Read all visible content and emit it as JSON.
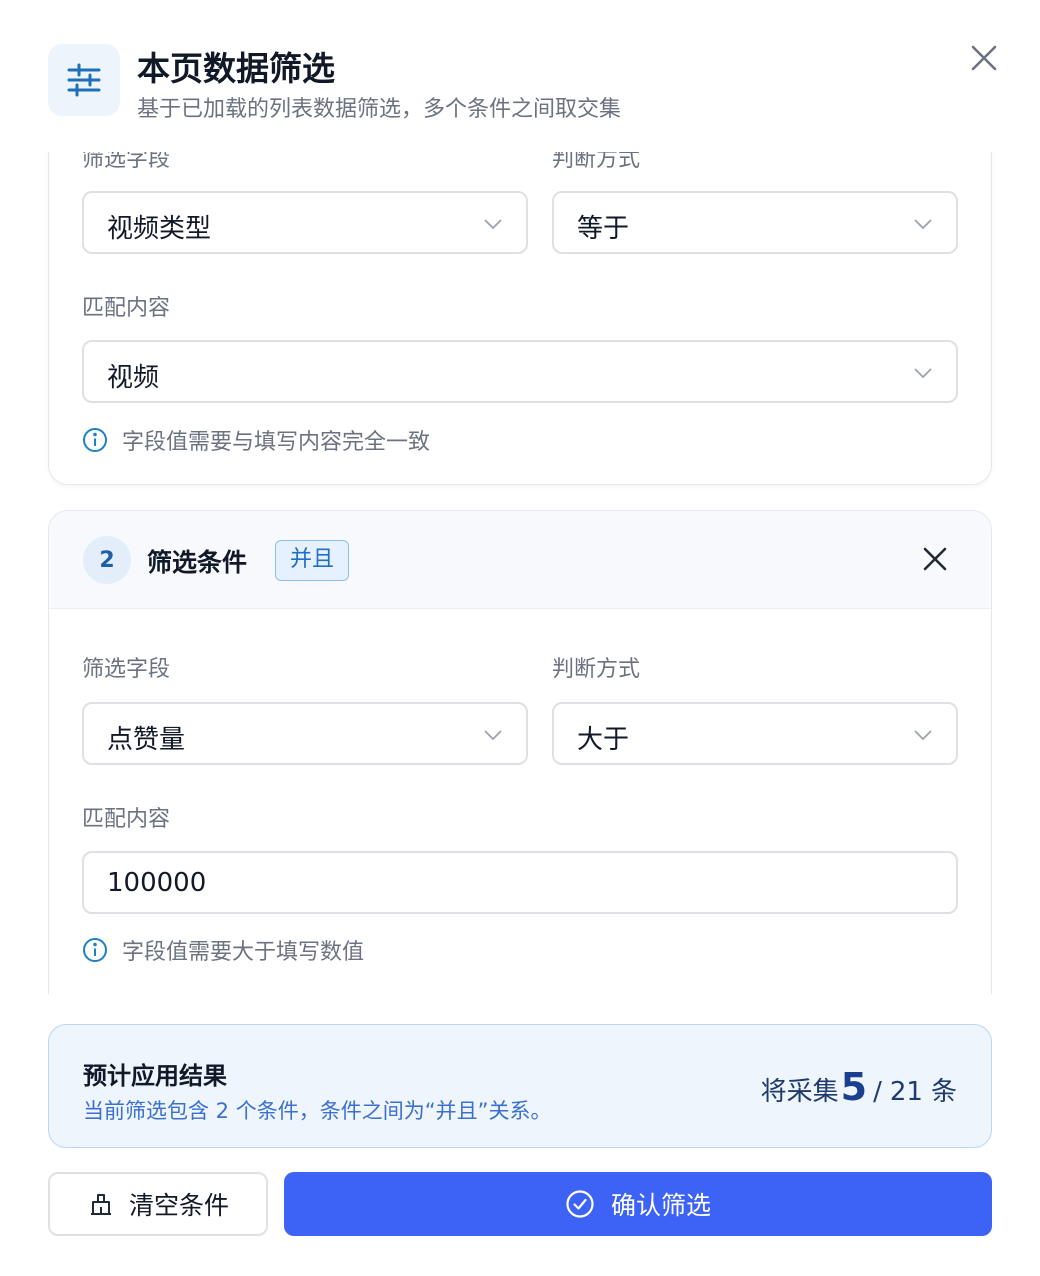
{
  "header": {
    "title": "本页数据筛选",
    "subtitle": "基于已加载的列表数据筛选，多个条件之间取交集"
  },
  "conditions": [
    {
      "field_label": "筛选字段",
      "field_value": "视频类型",
      "operator_label": "判断方式",
      "operator_value": "等于",
      "match_label": "匹配内容",
      "match_value": "视频",
      "hint": "字段值需要与填写内容完全一致"
    },
    {
      "index": "2",
      "title": "筛选条件",
      "logic_tag": "并且",
      "field_label": "筛选字段",
      "field_value": "点赞量",
      "operator_label": "判断方式",
      "operator_value": "大于",
      "match_label": "匹配内容",
      "match_value": "100000",
      "hint": "字段值需要大于填写数值"
    }
  ],
  "summary": {
    "title": "预计应用结果",
    "description": "当前筛选包含 2 个条件，条件之间为“并且”关系。",
    "prefix": "将采集",
    "matched": "5",
    "separator": "/",
    "total": "21",
    "unit": "条"
  },
  "footer": {
    "clear_label": "清空条件",
    "confirm_label": "确认筛选"
  },
  "colors": {
    "primary": "#3d63f6",
    "tag_blue": "#1f6fc6",
    "hint_icon": "#1d7fc4"
  }
}
